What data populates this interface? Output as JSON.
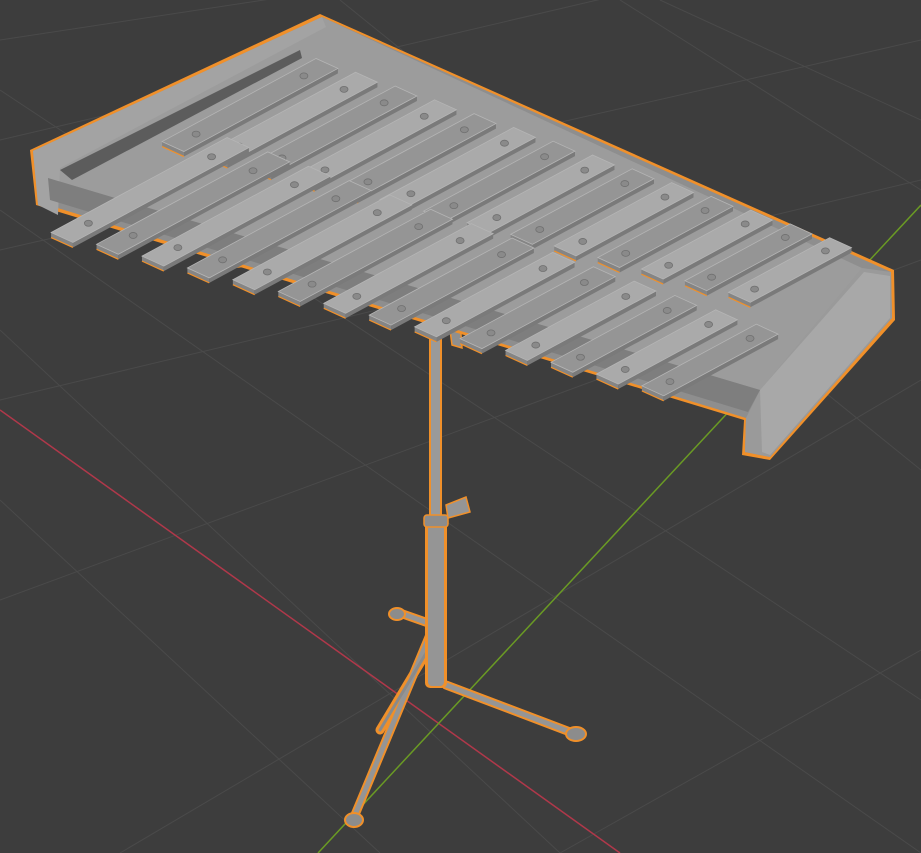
{
  "viewport": {
    "background_color": "#3d3d3d",
    "grid_line_color": "#4a4a4a",
    "x_axis_color": "#b0384a",
    "y_axis_color": "#6a9a24",
    "selection_outline_color": "#f0902a",
    "object_base_color": "#959595",
    "object_shadow_color": "#7a7a7a",
    "object_highlight_color": "#aaaaaa"
  },
  "object": {
    "icon": "glockenspiel-icon",
    "selected": true,
    "bar_count": 28
  }
}
